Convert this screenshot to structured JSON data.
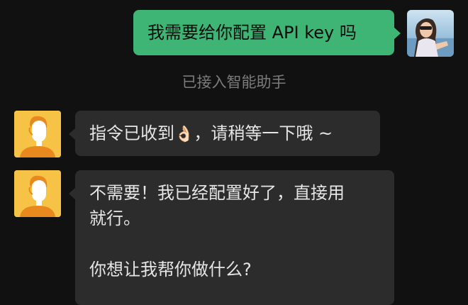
{
  "chat": {
    "messages": [
      {
        "sender": "user",
        "text": "我需要给你配置 API key 吗"
      },
      {
        "sender": "system",
        "text": "已接入智能助手"
      },
      {
        "sender": "assistant",
        "text_before": "指令已收到",
        "emoji": "👌🏻",
        "text_after": "，请稍等一下哦 ~"
      },
      {
        "sender": "assistant",
        "lines": [
          "不需要！我已经配置好了，直接用",
          "就行。"
        ],
        "question": "你想让我帮你做什么?"
      }
    ]
  },
  "colors": {
    "background": "#111111",
    "user_bubble": "#3eb575",
    "assistant_bubble": "#2c2c2c",
    "assistant_avatar": "#f6c346"
  },
  "icons": {
    "user_avatar": "user-photo-avatar",
    "assistant_avatar": "assistant-person-avatar"
  }
}
